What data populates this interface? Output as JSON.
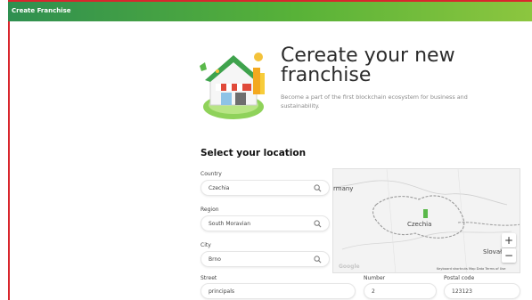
{
  "header": {
    "title": "Create Franchise"
  },
  "hero": {
    "title_line1": "Cereate your new",
    "title_line2": "franchise",
    "subtitle": "Become a part of the first blockchain ecosystem for business and sustainability."
  },
  "location": {
    "section_title": "Select your location",
    "country": {
      "label": "Country",
      "value": "Czechia"
    },
    "region": {
      "label": "Region",
      "value": "South Moravian"
    },
    "city": {
      "label": "City",
      "value": "Brno"
    },
    "street": {
      "label": "Street",
      "value": "principals"
    },
    "number": {
      "label": "Number",
      "value": "2"
    },
    "postal": {
      "label": "Postal code",
      "value": "123123"
    }
  },
  "map": {
    "labels": {
      "germany": "rmany",
      "czechia": "Czechia",
      "slovakia": "Slovał"
    },
    "zoom_in": "+",
    "zoom_out": "−",
    "google": "Google",
    "attribution": "Keyboard shortcuts   Map Data   Terms of Use"
  },
  "colors": {
    "accent": "#58b238",
    "border_red": "#d9262d"
  }
}
